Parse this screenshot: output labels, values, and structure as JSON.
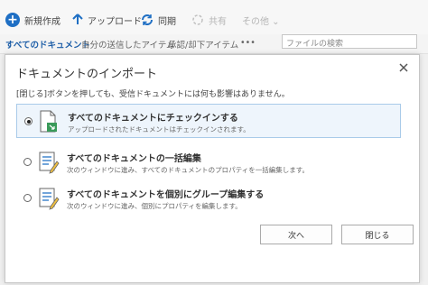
{
  "toolbar": {
    "new_label": "新規作成",
    "upload_label": "アップロード",
    "sync_label": "同期",
    "share_label": "共有",
    "more_label": "その他 ⌄"
  },
  "views": {
    "all_documents": "すべてのドキュメント",
    "my_sent": "自分の送信したアイテム",
    "approve": "承認/却下アイテム",
    "more": "•••"
  },
  "search": {
    "placeholder": "ファイルの検索"
  },
  "dialog": {
    "title": "ドキュメントのインポート",
    "instruction": "[閉じる]ボタンを押しても、受信ドキュメントには何も影響はありません。",
    "options": [
      {
        "title": "すべてのドキュメントにチェックインする",
        "desc": "アップロードされたドキュメントはチェックインされます。",
        "selected": true
      },
      {
        "title": "すべてのドキュメントの一括編集",
        "desc": "次のウィンドウに進み、すべてのドキュメントのプロパティを一括編集します。",
        "selected": false
      },
      {
        "title": "すべてのドキュメントを個別にグループ編集する",
        "desc": "次のウィンドウに進み、個別にプロパティを編集します。",
        "selected": false
      }
    ],
    "next_label": "次へ",
    "close_label": "閉じる"
  },
  "colors": {
    "accent": "#1f6fc4",
    "selected_bg": "#eef5fc",
    "selected_border": "#a9cbe9"
  }
}
